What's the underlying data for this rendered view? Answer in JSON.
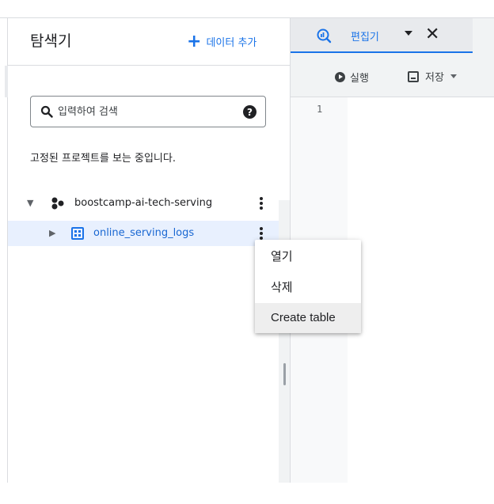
{
  "explorer": {
    "title": "탐색기",
    "add_data_label": "데이터 추가",
    "search": {
      "placeholder": "입력하여 검색",
      "value": ""
    },
    "pinned_message": "고정된 프로젝트를 보는 중입니다.",
    "project": {
      "name": "boostcamp-ai-tech-serving",
      "expanded": true
    },
    "dataset": {
      "name": "online_serving_logs",
      "expanded": false,
      "selected": true
    }
  },
  "context_menu": {
    "items": [
      {
        "label": "열기"
      },
      {
        "label": "삭제"
      },
      {
        "label": "Create table",
        "highlighted": true
      }
    ]
  },
  "editor": {
    "tab_label": "편집기",
    "run_label": "실행",
    "save_label": "저장",
    "line_numbers": [
      "1"
    ]
  },
  "colors": {
    "accent": "#1a73e8",
    "selected_row_bg": "#e8f0fe",
    "toolbar_bg": "#f1f3f4"
  },
  "icons": {
    "add": "plus-icon",
    "search": "search-icon",
    "help": "help-icon",
    "project": "project-icon",
    "dataset": "dataset-icon",
    "more": "more-vert-icon",
    "tab": "query-icon",
    "run": "play-icon",
    "save": "save-icon"
  }
}
